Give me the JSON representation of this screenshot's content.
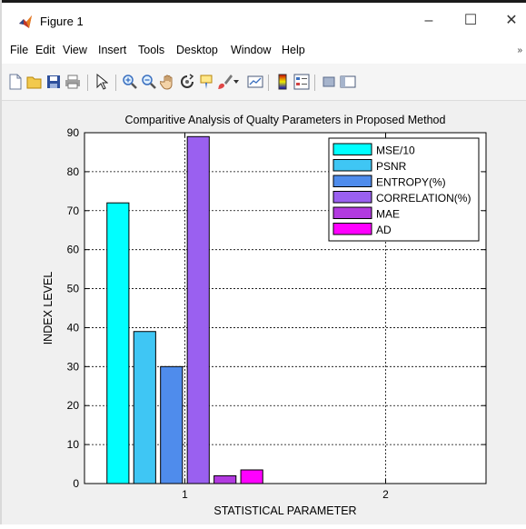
{
  "window": {
    "title": "Figure 1",
    "minimize_glyph": "–",
    "maximize_glyph": "☐",
    "close_glyph": "✕"
  },
  "menu": {
    "items": [
      "File",
      "Edit",
      "View",
      "Insert",
      "Tools",
      "Desktop",
      "Window",
      "Help"
    ],
    "overflow_glyph": "»"
  },
  "toolbar": {
    "icons": [
      "new-figure-icon",
      "open-file-icon",
      "save-icon",
      "print-icon",
      "edit-plot-arrow-icon",
      "zoom-in-icon",
      "zoom-out-icon",
      "pan-hand-icon",
      "rotate-3d-icon",
      "data-cursor-icon",
      "brush-icon",
      "brush-dropdown-icon",
      "link-plot-icon",
      "insert-colorbar-icon",
      "insert-legend-icon",
      "hide-plot-tools-icon",
      "show-plot-tools-icon"
    ]
  },
  "colors": {
    "MSE/10": "#00ffff",
    "PSNR": "#3fc6f4",
    "ENTROPY(%)": "#4f8cec",
    "CORRELATION(%)": "#9a60f0",
    "MAE": "#b23ae0",
    "AD": "#ff00ff"
  },
  "chart_data": {
    "type": "bar",
    "title": "Comparitive Analysis of Qualty Parameters in Proposed Method",
    "xlabel": "STATISTICAL PARAMETER",
    "ylabel": "INDEX LEVEL",
    "categories": [
      "1",
      "2"
    ],
    "xlim": [
      0.5,
      2.5
    ],
    "ylim": [
      0,
      90
    ],
    "yticks": [
      0,
      10,
      20,
      30,
      40,
      50,
      60,
      70,
      80,
      90
    ],
    "grid": true,
    "legend_position": "top-right",
    "series": [
      {
        "name": "MSE/10",
        "values": [
          72,
          0
        ]
      },
      {
        "name": "PSNR",
        "values": [
          39,
          0
        ]
      },
      {
        "name": "ENTROPY(%)",
        "values": [
          30,
          0
        ]
      },
      {
        "name": "CORRELATION(%)",
        "values": [
          89,
          0
        ]
      },
      {
        "name": "MAE",
        "values": [
          2,
          0
        ]
      },
      {
        "name": "AD",
        "values": [
          3.5,
          0
        ]
      }
    ]
  }
}
